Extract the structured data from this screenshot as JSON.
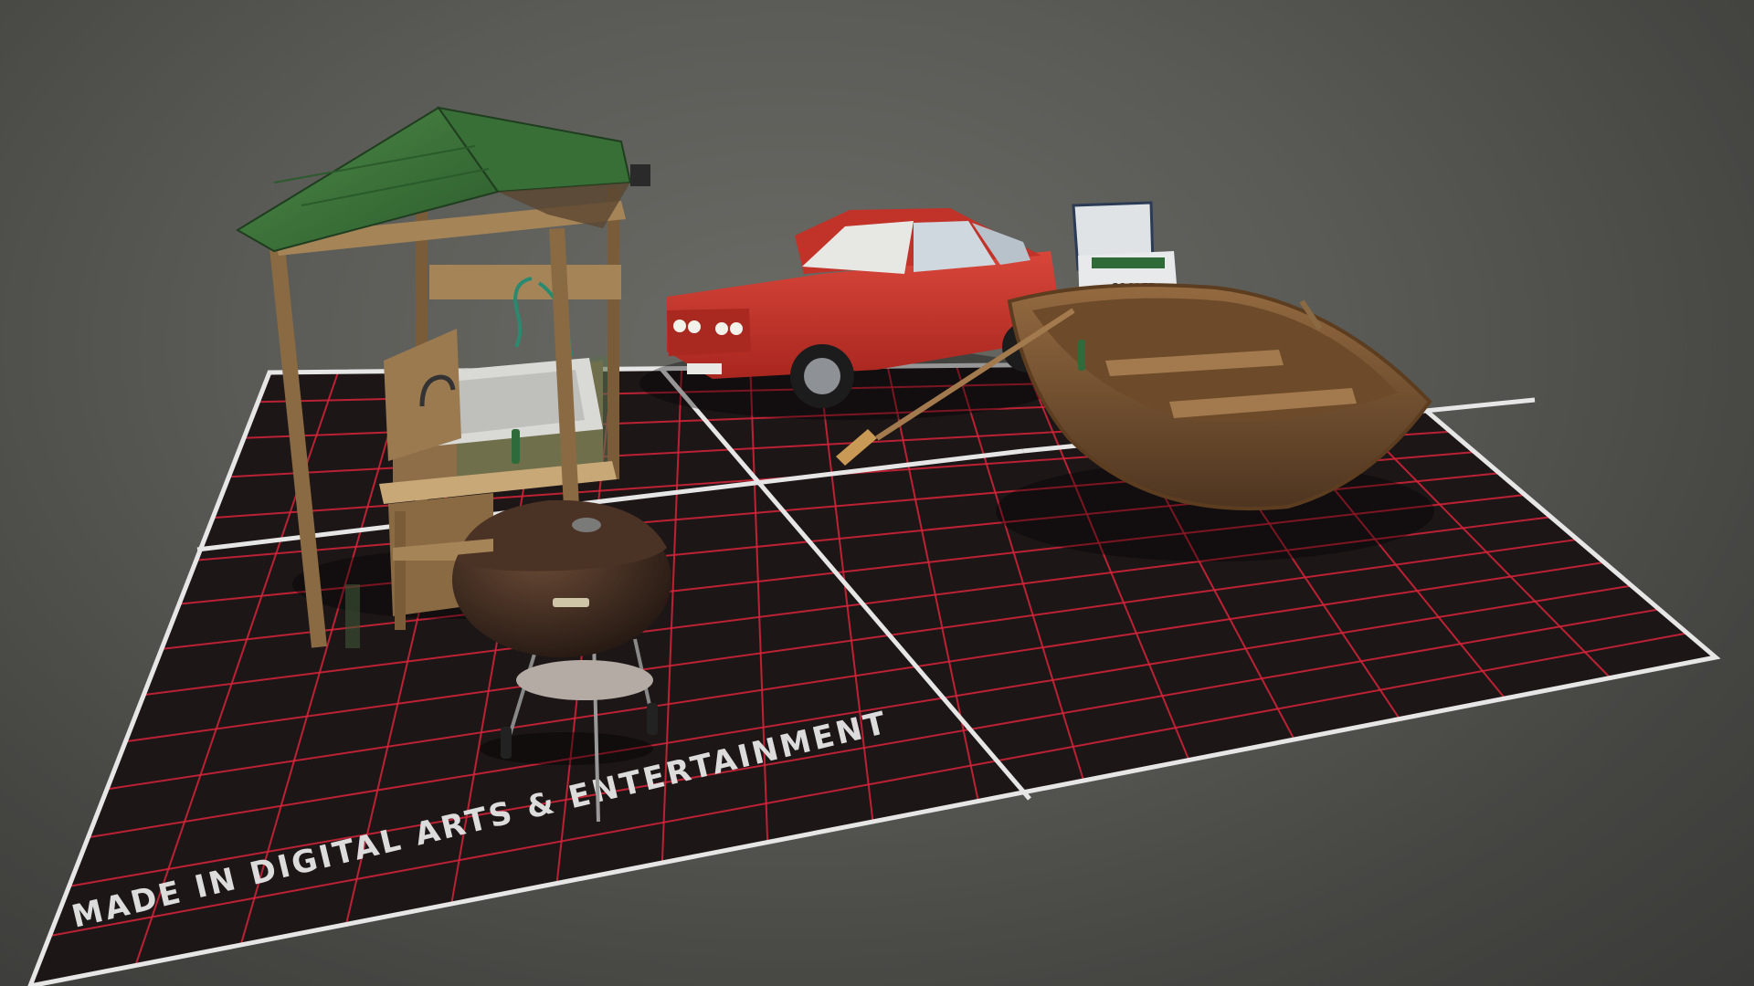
{
  "scene": {
    "floor_caption": "MADE IN DIGITAL ARTS & ENTERTAINMENT",
    "cooler_label": "COOLER",
    "colors": {
      "background": "#5a5a56",
      "floor": "#1d1617",
      "grid_line": "#d8243a",
      "floor_border": "#e8e8e8",
      "roof": "#3f7a3c",
      "wood": "#8a6a42",
      "car": "#c8362c",
      "boat": "#7a5230",
      "grill": "#3a2a22"
    },
    "objects": [
      "pavilion-with-sink",
      "red-car",
      "cooler",
      "rowboat",
      "charcoal-grill"
    ]
  }
}
